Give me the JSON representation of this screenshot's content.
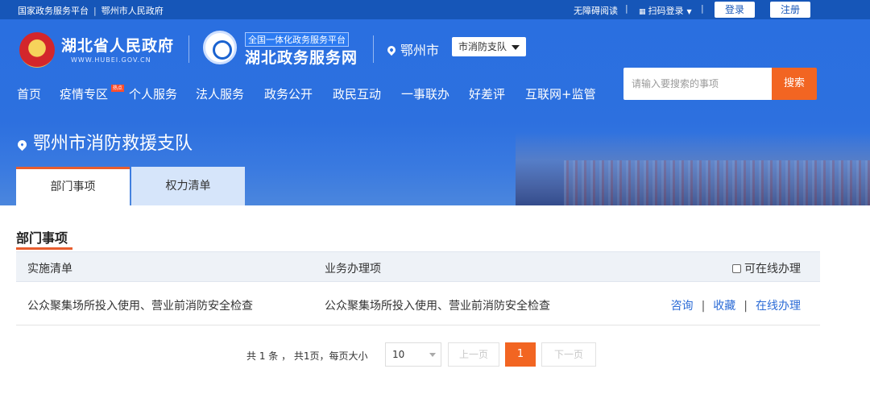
{
  "topbar": {
    "left_link1": "国家政务服务平台",
    "left_sep": "|",
    "left_link2": "鄂州市人民政府",
    "accessibility": "无障碍阅读",
    "separator": "|",
    "scan_login": "扫码登录",
    "login": "登录",
    "register": "注册"
  },
  "header": {
    "gov_name": "湖北省人民政府",
    "gov_url": "WWW.HUBEI.GOV.CN",
    "platform_tag": "全国一体化政务服务平台",
    "platform_name": "湖北政务服务网",
    "city": "鄂州市",
    "dept_selected": "市消防支队"
  },
  "nav": {
    "items": [
      "首页",
      "疫情专区",
      "个人服务",
      "法人服务",
      "政务公开",
      "政民互动",
      "一事联办",
      "好差评",
      "互联网+监管"
    ],
    "badge": "热点"
  },
  "search": {
    "placeholder": "请输入要搜索的事项",
    "button": "搜索"
  },
  "page": {
    "title": "鄂州市消防救援支队",
    "tabs": [
      "部门事项",
      "权力清单"
    ],
    "active_tab": 0
  },
  "section": {
    "title": "部门事项",
    "columns": [
      "实施清单",
      "业务办理项",
      "可在线办理"
    ],
    "rows": [
      {
        "item": "公众聚集场所投入使用、营业前消防安全检查",
        "business": "公众聚集场所投入使用、营业前消防安全检查",
        "actions": [
          "咨询",
          "收藏",
          "在线办理"
        ]
      }
    ]
  },
  "pager": {
    "info": "共 1 条 ， 共1页，每页大小",
    "page_size": "10",
    "prev": "上一页",
    "current": "1",
    "next": "下一页"
  },
  "colors": {
    "brand_blue": "#1656b8",
    "accent_orange": "#f26522",
    "link_blue": "#2b6bd6"
  }
}
